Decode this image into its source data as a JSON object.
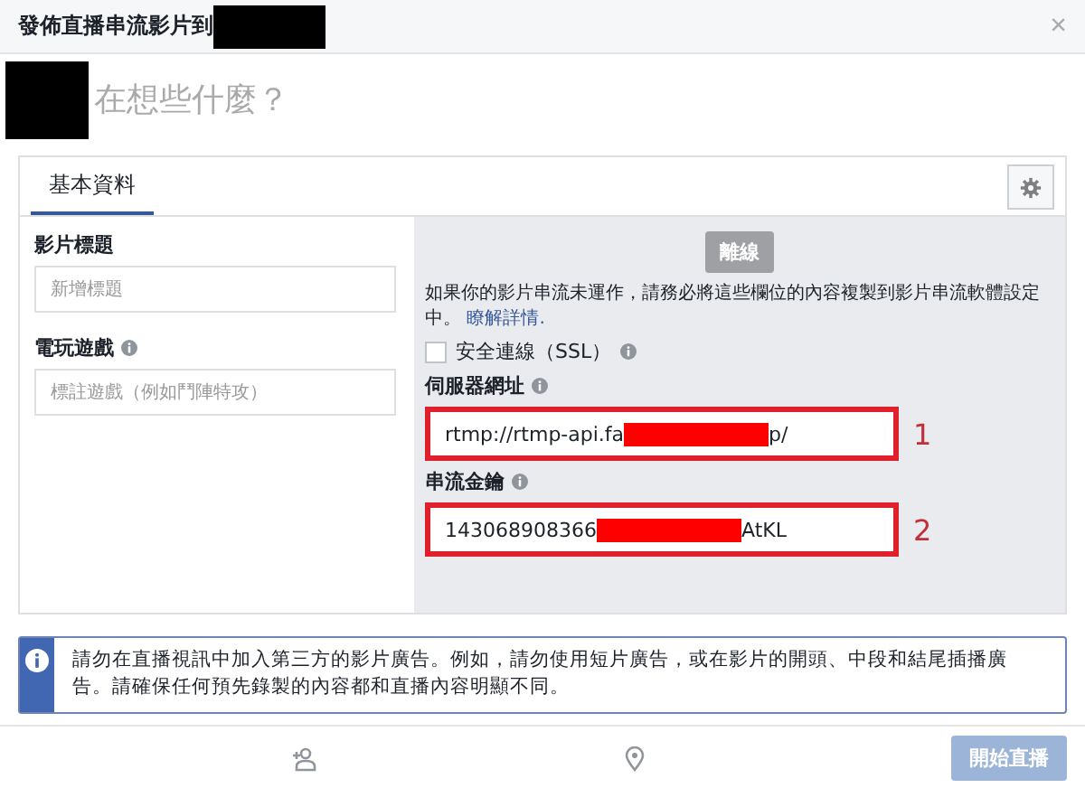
{
  "dialog": {
    "title": "發佈直播串流影片到",
    "title_redacted": true,
    "close": "×"
  },
  "composer": {
    "avatar_redacted": true,
    "placeholder": "在想些什麼？"
  },
  "tabs": [
    {
      "label": "基本資料",
      "selected": true
    }
  ],
  "left": {
    "fields": [
      {
        "label": "影片標題",
        "info": false,
        "placeholder": "新增標題"
      },
      {
        "label": "電玩遊戲",
        "info": true,
        "placeholder": "標註遊戲（例如鬥陣特攻）"
      }
    ]
  },
  "right": {
    "offline_button": "離線",
    "notice": "如果你的影片串流未運作，請務必將這些欄位的內容複製到影片串流軟體設定中。",
    "link": "瞭解詳情.",
    "ssl": {
      "label": "安全連線（SSL）",
      "checked": false,
      "info": true
    },
    "fields": [
      {
        "label": "伺服器網址",
        "info": true,
        "value_before": "rtmp://rtmp-api.fa",
        "value_after": "p/",
        "redacted": true,
        "annotation": "1"
      },
      {
        "label": "串流金鑰",
        "info": true,
        "value_before": "143068908366",
        "value_after": "AtKL",
        "redacted": true,
        "annotation": "2"
      }
    ]
  },
  "info_banner": "請勿在直播視訊中加入第三方的影片廣告。例如，請勿使用短片廣告，或在影片的開頭、中段和結尾插播廣告。請確保任何預先錄製的內容都和直播內容明顯不同。",
  "footer": {
    "start_button": {
      "label": "開始直播",
      "disabled": true
    }
  }
}
